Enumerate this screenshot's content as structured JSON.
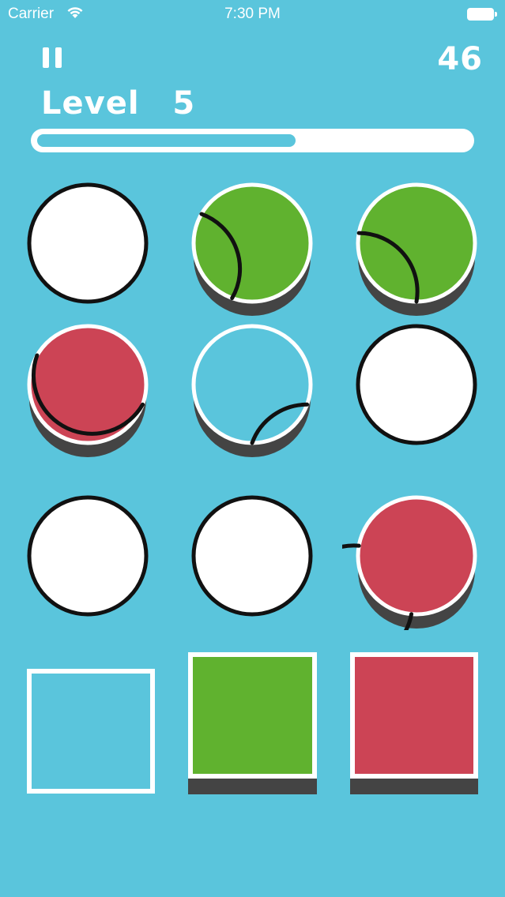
{
  "status_bar": {
    "carrier": "Carrier",
    "time": "7:30 PM",
    "wifi_icon": "wifi-icon",
    "battery_icon": "battery-icon"
  },
  "hud": {
    "pause_icon": "pause-icon",
    "score": "46",
    "level_title": "Level  5",
    "progress": 0.6
  },
  "colors": {
    "background": "#5ac5dc",
    "green": "#60b22f",
    "red": "#cc4455",
    "white": "#ffffff",
    "shadow": "#444444",
    "ring": "#111111"
  },
  "circles": [
    {
      "fill": "white",
      "shadow": false
    },
    {
      "fill": "green",
      "shadow": true
    },
    {
      "fill": "green",
      "shadow": true
    },
    {
      "fill": "red",
      "shadow": true
    },
    {
      "fill": "empty",
      "shadow": true
    },
    {
      "fill": "white",
      "shadow": false
    },
    {
      "fill": "white",
      "shadow": false
    },
    {
      "fill": "white",
      "shadow": false
    },
    {
      "fill": "red",
      "shadow": true
    }
  ],
  "squares": [
    {
      "fill": "empty",
      "shadow": false
    },
    {
      "fill": "green",
      "shadow": true
    },
    {
      "fill": "red",
      "shadow": true
    }
  ]
}
